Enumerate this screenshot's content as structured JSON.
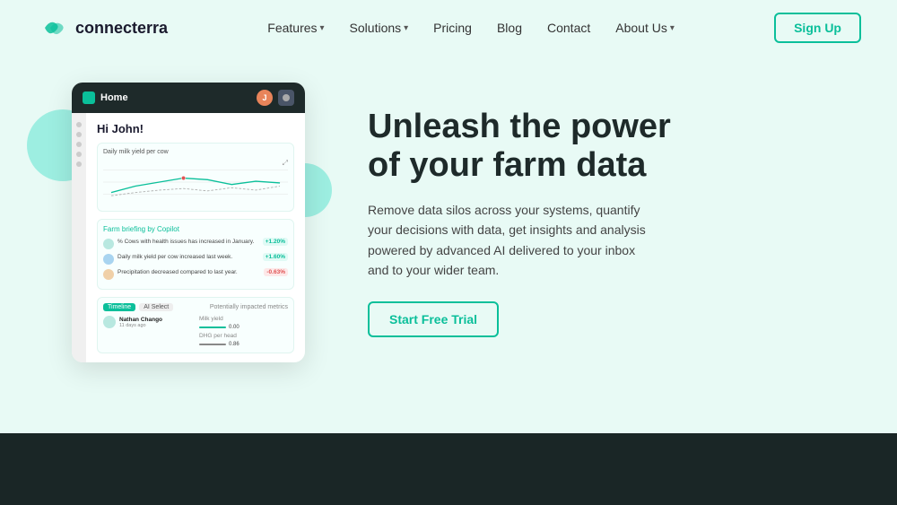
{
  "brand": {
    "name": "connecterra",
    "logo_alt": "Connecterra Logo"
  },
  "navbar": {
    "features_label": "Features",
    "solutions_label": "Solutions",
    "pricing_label": "Pricing",
    "blog_label": "Blog",
    "contact_label": "Contact",
    "about_label": "About Us",
    "signup_label": "Sign Up"
  },
  "dashboard": {
    "topbar_title": "Home",
    "greeting": "Hi John!",
    "chart_title": "Daily milk yield per cow",
    "briefing_header": "Farm briefing",
    "briefing_by": "by Copilot",
    "briefing_items": [
      {
        "text": "% Cows with health issues has increased in January.",
        "badge": "+1.20%",
        "type": "green"
      },
      {
        "text": "Daily milk yield per cow increased last week.",
        "badge": "+1.60%",
        "type": "green"
      },
      {
        "text": "Precipitation decreased compared to last year.",
        "badge": "-0.63%",
        "type": "red"
      }
    ],
    "tab_timeline": "Timeline",
    "tab_ai": "AI Select",
    "potentially_impacted": "Potentially impacted metrics",
    "milk_yield_label": "Milk yield",
    "dhg_label": "DHG per head",
    "animal_name": "Nathan Chango",
    "animal_sub": "11 days ago",
    "metric_val1": "0.00",
    "metric_val2": "0.86"
  },
  "hero": {
    "title_line1": "Unleash the power",
    "title_line2": "of your farm data",
    "subtitle": "Remove data silos across your systems, quantify your decisions with data, get insights and analysis powered by advanced AI delivered to your inbox and to your wider team.",
    "cta_label": "Start Free Trial"
  },
  "colors": {
    "accent": "#0abf9a",
    "dark": "#1e2a2a",
    "bg": "#e8faf5"
  }
}
